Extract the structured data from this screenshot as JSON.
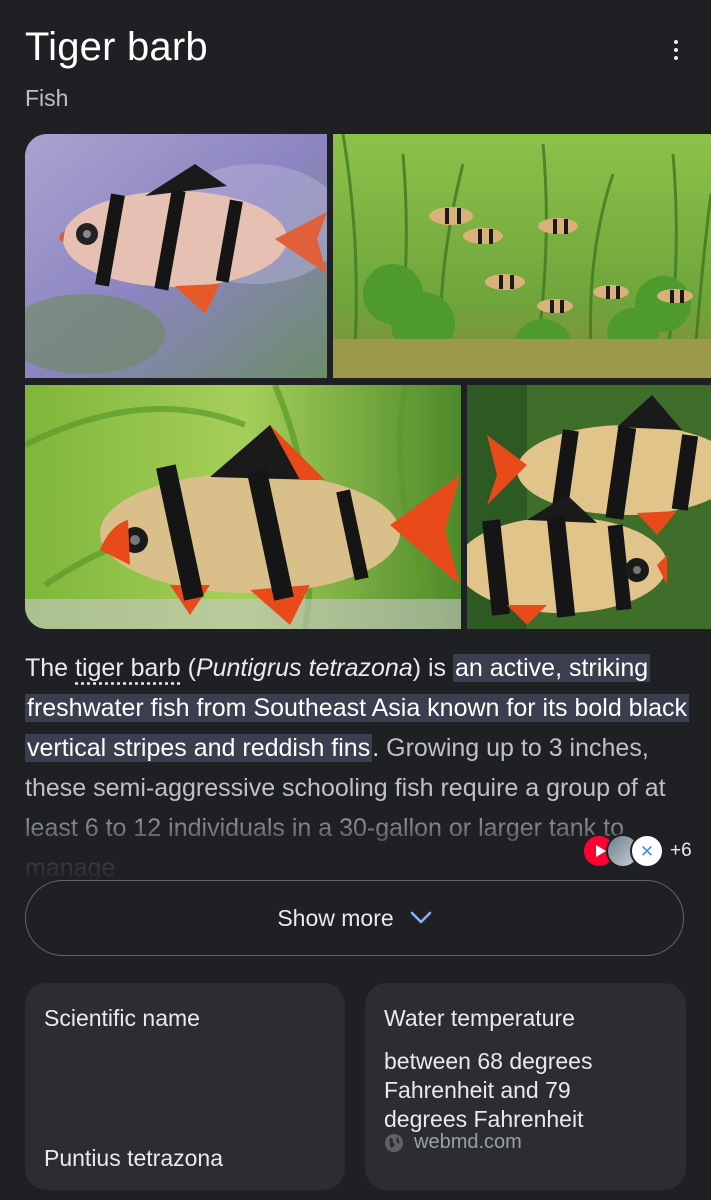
{
  "header": {
    "title": "Tiger barb",
    "subtitle": "Fish"
  },
  "images": [
    {
      "icon": "fish-photo"
    },
    {
      "icon": "aquarium-photo"
    },
    {
      "icon": "fish-photo"
    },
    {
      "icon": "fish-photo"
    }
  ],
  "description": {
    "text_before_link": "The ",
    "link": "tiger barb",
    "text_after_link": " (",
    "italic_name": "Puntigrus tetrazona",
    "text_after_italic": ") is ",
    "highlight": "an active, striking freshwater fish from Southeast Asia known for its bold black vertical stripes and reddish fins",
    "period": ".",
    "rest": " Growing up to 3 inches, these semi-aggressive schooling fish require a group of at least 6 to 12 individuals in a 30-gallon or larger tank to manage"
  },
  "sources": {
    "count_label": "+6"
  },
  "show_more": {
    "label": "Show more"
  },
  "facts": [
    {
      "label": "Scientific name",
      "value": "Puntius tetrazona"
    },
    {
      "label": "Water temperature",
      "value": "between 68 degrees Fahrenheit and 79 degrees Fahrenheit",
      "source": "webmd.com"
    }
  ],
  "colors": {
    "background": "#1f2023",
    "card": "#2c2d31",
    "highlight": "#3b3e4f",
    "accent_chevron": "#8ab4f8"
  }
}
